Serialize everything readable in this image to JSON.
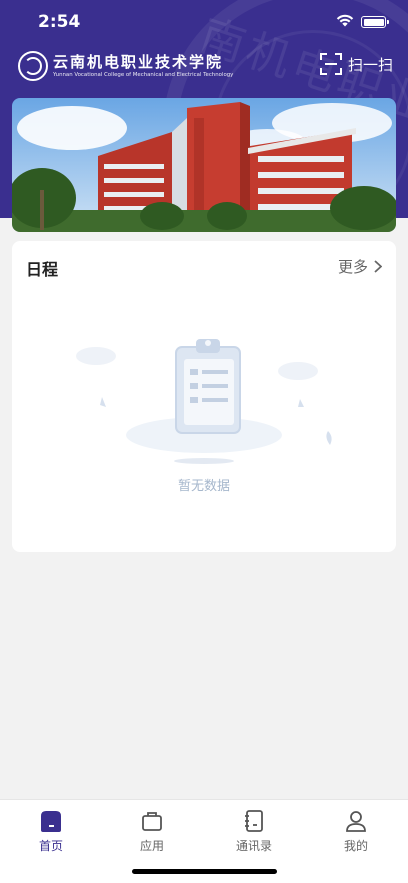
{
  "status_bar": {
    "time": "2:54",
    "icons": [
      "wifi-icon",
      "battery-icon"
    ]
  },
  "header": {
    "logo_cn": "云南机电职业技术学院",
    "logo_en": "Yunnan Vocational College of Mechanical and Electrical Technology",
    "seal_text": "南机电职业技术",
    "scan_label": "扫一扫",
    "accent": "#3a2f8f"
  },
  "schedule": {
    "title": "日程",
    "more_label": "更多",
    "empty_text": "暂无数据"
  },
  "tabbar": {
    "tabs": [
      {
        "label": "首页",
        "icon": "home-icon",
        "active": true
      },
      {
        "label": "应用",
        "icon": "briefcase-icon",
        "active": false
      },
      {
        "label": "通讯录",
        "icon": "contacts-book-icon",
        "active": false
      },
      {
        "label": "我的",
        "icon": "user-icon",
        "active": false
      }
    ]
  }
}
